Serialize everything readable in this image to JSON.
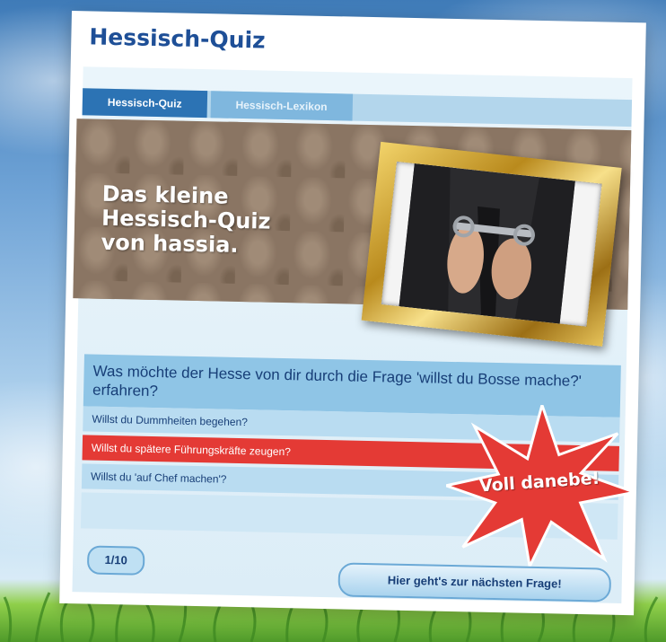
{
  "app": {
    "title": "Hessisch-Quiz"
  },
  "tabs": [
    {
      "label": "Hessisch-Quiz",
      "active": true
    },
    {
      "label": "Hessisch-Lexikon",
      "active": false
    }
  ],
  "banner": {
    "line1": "Das kleine",
    "line2": "Hessisch-Quiz",
    "line3": "von hassia."
  },
  "question": {
    "text": "Was möchte der Hesse von dir durch die Frage 'willst du Bosse mache?' erfahren?",
    "answers": [
      {
        "label": "Willst du Dummheiten begehen?",
        "state": "normal"
      },
      {
        "label": "Willst du spätere Führungskräfte zeugen?",
        "state": "wrong"
      },
      {
        "label": "Willst du 'auf Chef machen'?",
        "state": "normal"
      }
    ],
    "feedback": "Voll danebe!"
  },
  "progress": {
    "counter": "1/10"
  },
  "next_button": "Hier geht's zur nächsten Frage!",
  "colors": {
    "accent": "#1e4f97",
    "wrong": "#e43a35",
    "tab_active": "#2c73b4"
  }
}
